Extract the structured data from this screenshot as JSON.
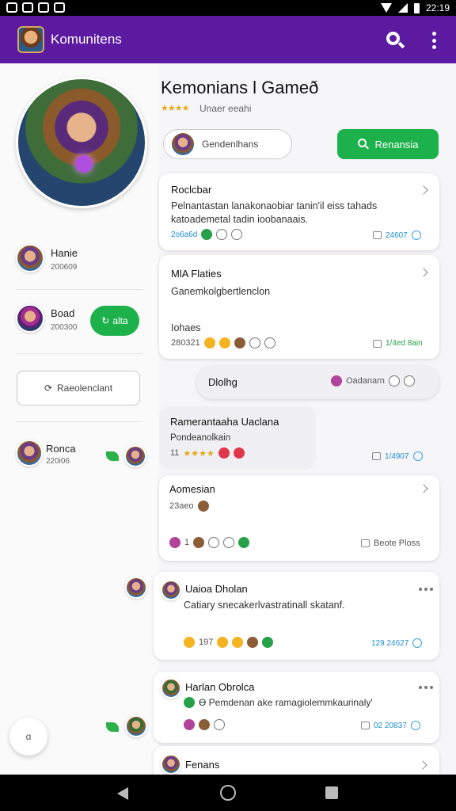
{
  "status_bar": {
    "time": "22:19"
  },
  "app_bar": {
    "title": "Komunitens",
    "icons": [
      "app-logo",
      "search-icon",
      "more-vert-icon"
    ]
  },
  "header": {
    "title": "Kemonians l Gameð",
    "stars": "★★★★",
    "subtitle": "Unaer eeahi",
    "search_placeholder": "Gendenlhans",
    "search_button": "Renansia"
  },
  "sidebar": {
    "users": [
      {
        "name": "Hanie",
        "meta": "200609"
      },
      {
        "name": "Boad",
        "meta": "200300",
        "button": "alta"
      },
      {
        "name": "Ronca",
        "meta": "220i06"
      }
    ],
    "outline_button": "Raeolenclant",
    "float_label": "ɑ"
  },
  "posts": [
    {
      "title": "Roclcbar",
      "body": "Pelnantastan lanakonaobiar tanin'il eiss tahads katoademetal tadin ioobanaais.",
      "meta": "2o6a6d",
      "count": "24607"
    },
    {
      "title": "MlA Flaties",
      "body": "Ganemkolgbertlenclon",
      "sub": "Iohaes",
      "meta": "280321",
      "count": "1/4ed 8ain"
    },
    {
      "title": "Dlolhg",
      "right": "Oadanarn"
    },
    {
      "title": "Ramerantaaha Uaclana",
      "body": "Pondeanolkain",
      "meta": "11",
      "count": "1/4907"
    },
    {
      "title": "Aomesian",
      "body": "23aeo",
      "meta": "1",
      "right": "Beote Ploss"
    },
    {
      "title": "Uaioa Dholan",
      "body": "Catiary snecakerlvastratinall skatanf.",
      "meta": "197",
      "count": "129 24627"
    },
    {
      "title": "Harlan Obrolca",
      "body": "Ɵ Pemdenan ake ramagiolemmkaurinaly'",
      "count": "02 20837"
    },
    {
      "title": "Fenans"
    }
  ]
}
